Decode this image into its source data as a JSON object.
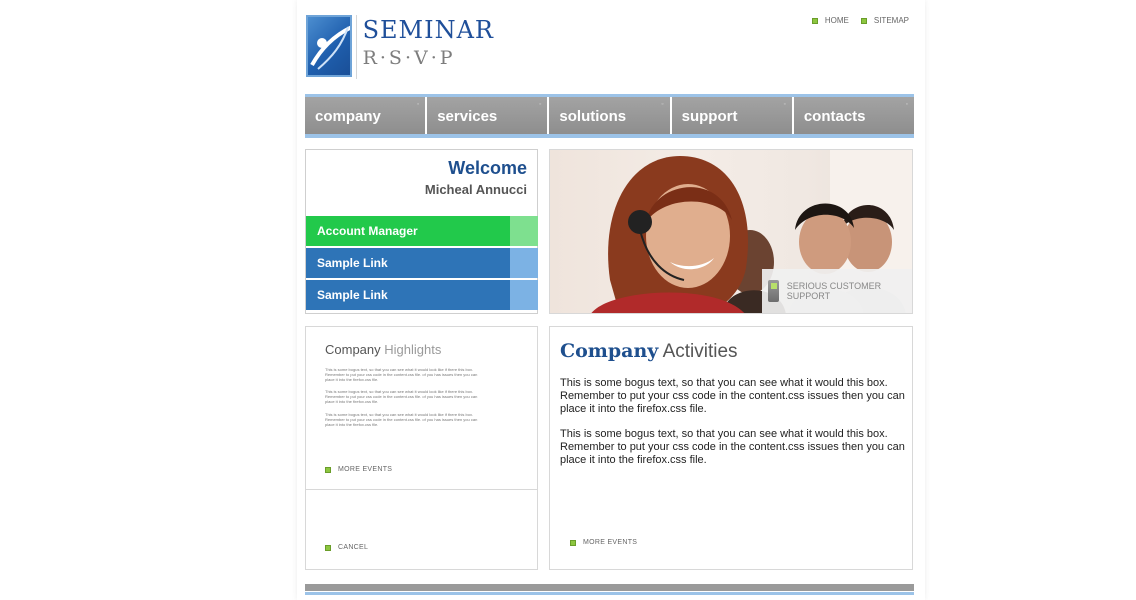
{
  "brand": {
    "title": "SEMINAR",
    "subtitle": "R·S·V·P"
  },
  "toplinks": [
    "HOME",
    "SITEMAP"
  ],
  "nav": [
    {
      "label": "company"
    },
    {
      "label": "services"
    },
    {
      "label": "solutions"
    },
    {
      "label": "support"
    },
    {
      "label": "contacts"
    }
  ],
  "welcome": {
    "title": "Welcome",
    "name": "Micheal Annucci"
  },
  "side_links": [
    "Account Manager",
    "Sample Link",
    "Sample Link"
  ],
  "hero": {
    "caption": "SERIOUS CUSTOMER SUPPORT"
  },
  "highlights": {
    "title_a": "Company",
    "title_b": "Highlights",
    "para": "This is some bogus text, so that you can see what it would look like if there this box. Remember to put your css code in the content.css file. of you has issues then you can place it into the firefox.css file.",
    "more": "MORE EVENTS",
    "cancel": "CANCEL"
  },
  "activities": {
    "title_a": "Company",
    "title_b": "Activities",
    "p1": "This is some bogus text, so that you can see what it would this box. Remember to put your css code in the content.css issues then you can place it into the firefox.css file.",
    "p2": "This is some bogus text, so that you can see what it would this box. Remember to put your css code in the content.css issues then you can place it into the firefox.css file.",
    "more": "MORE EVENTS"
  },
  "colors": {
    "accent_blue": "#1e4f8e",
    "nav_gray": "#9a9a9a",
    "green_link": "#22c94b",
    "blue_link": "#2e74b7",
    "bullet_green": "#8cc63f"
  }
}
